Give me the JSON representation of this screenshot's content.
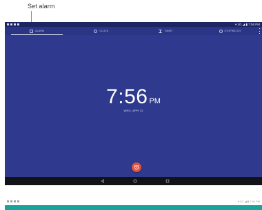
{
  "annotation": {
    "label": "Set alarm"
  },
  "status_bar": {
    "right_text": "▾ 3G ◢ ▮ 7:56 PM"
  },
  "tabs": [
    {
      "label": "ALARM",
      "icon": "alarm-icon"
    },
    {
      "label": "CLOCK",
      "icon": "clock-icon"
    },
    {
      "label": "TIMER",
      "icon": "hourglass-icon"
    },
    {
      "label": "STOPWATCH",
      "icon": "stopwatch-icon"
    }
  ],
  "clock": {
    "time": "7:56",
    "ampm": "PM",
    "date": "WED, APR 11"
  },
  "fab": {
    "icon": "add-alarm-icon"
  },
  "nav": {
    "back": "back-icon",
    "home": "home-icon",
    "recents": "recents-icon"
  },
  "bottom_status": {
    "right_text": "▾ 3G ◢ ▮ 7:56 PM"
  },
  "colors": {
    "background": "#2f3a8f",
    "status_bar": "#1d2563",
    "accent": "#e2533f",
    "callout": "#29a8e0",
    "teal": "#1aa39a",
    "nav_bar": "#111319"
  }
}
